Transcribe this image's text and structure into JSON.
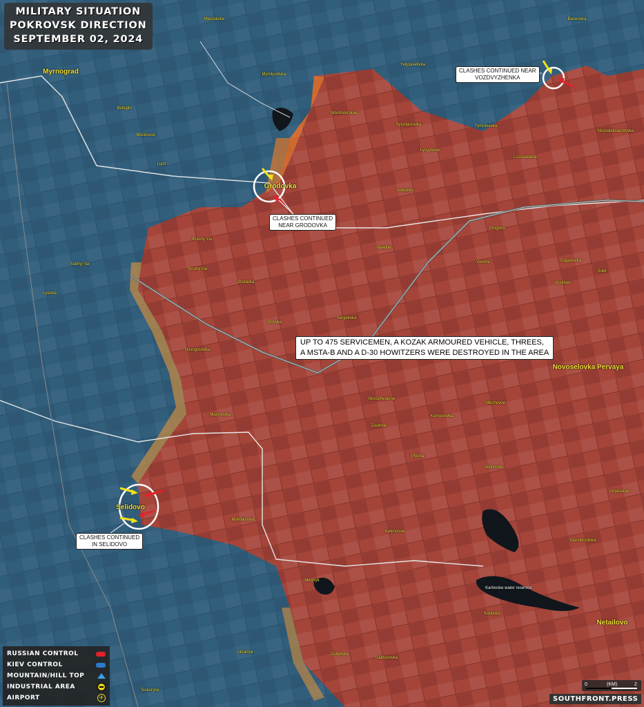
{
  "title": {
    "line1": "MILITARY SITUATION",
    "line2": "POKROVSK DIRECTION",
    "line3": "SEPTEMBER 02, 2024"
  },
  "major_places": [
    "Myrnograd",
    "Grodovka",
    "Selidovo",
    "Novoselovka Pervaya",
    "Netailovo"
  ],
  "places": [
    "Mykolaivka",
    "Myrolyubivka",
    "Yelyzavetivka",
    "Baranivka",
    "Novotoretskoe",
    "Syryndorovka",
    "Tymofeevka",
    "Novoaleksandrovka",
    "Lysychnoe",
    "Lozovatskoe",
    "Ivanovka",
    "Progress",
    "Vaseloe",
    "Vovche",
    "Evgenovka",
    "Sokil",
    "Voskhod",
    "Sergeevka",
    "Orlovka",
    "Zhuravka",
    "Krasny Yar",
    "Krutny Yar",
    "Sukhyi Yar",
    "Lysivka",
    "Novogrodivka",
    "Marynovka",
    "Novozhelanne",
    "Mezhovoe",
    "Komyshivka",
    "Zavitnoe",
    "Ptycha",
    "Skuchnoe",
    "Umanskoe",
    "Yasnobrodivka",
    "Kalynovoe",
    "Mykhailovka",
    "Memryk",
    "Karlovka",
    "Dolynivka",
    "Galitsinovka",
    "Ukrainsk",
    "Tsukuryne",
    "Beloglin",
    "Mozkovoe",
    "Luch"
  ],
  "water_label": "Karlovske water reservoir",
  "callouts": {
    "vozdvyzhenka_line1": "CLASHES CONTINUED NEAR",
    "vozdvyzhenka_line2": "VOZDVYZHENKA",
    "grodovka_line1": "CLASHES CONTINUED",
    "grodovka_line2": "NEAR GRODOVKA",
    "selidovo_line1": "CLASHES CONTINUED",
    "selidovo_line2": "IN SELIDOVO"
  },
  "banner": {
    "line1": "UP TO 475 SERVICEMEN, A KOZAK ARMOURED VEHICLE, THREES,",
    "line2": "A MSTA-B AND A D-30 HOWITZERS WERE DESTROYED IN THE AREA"
  },
  "legend": {
    "russian": "RUSSIAN CONTROL",
    "kiev": "KIEV CONTROL",
    "mountain": "MOUNTAIN/HILL TOP",
    "industrial": "INDUSTRIAL AREA",
    "airport": "AIRPORT"
  },
  "scale": {
    "left": "0",
    "unit": "(KM)",
    "right": "2"
  },
  "brand": "SOUTHFRONT.PRESS",
  "colors": {
    "russian": "#e0222a",
    "kiev": "#2d78c8",
    "label": "#f3e23a"
  },
  "icons": {
    "mountain": "triangle-icon",
    "industrial": "factory-icon",
    "airport": "plane-icon"
  }
}
